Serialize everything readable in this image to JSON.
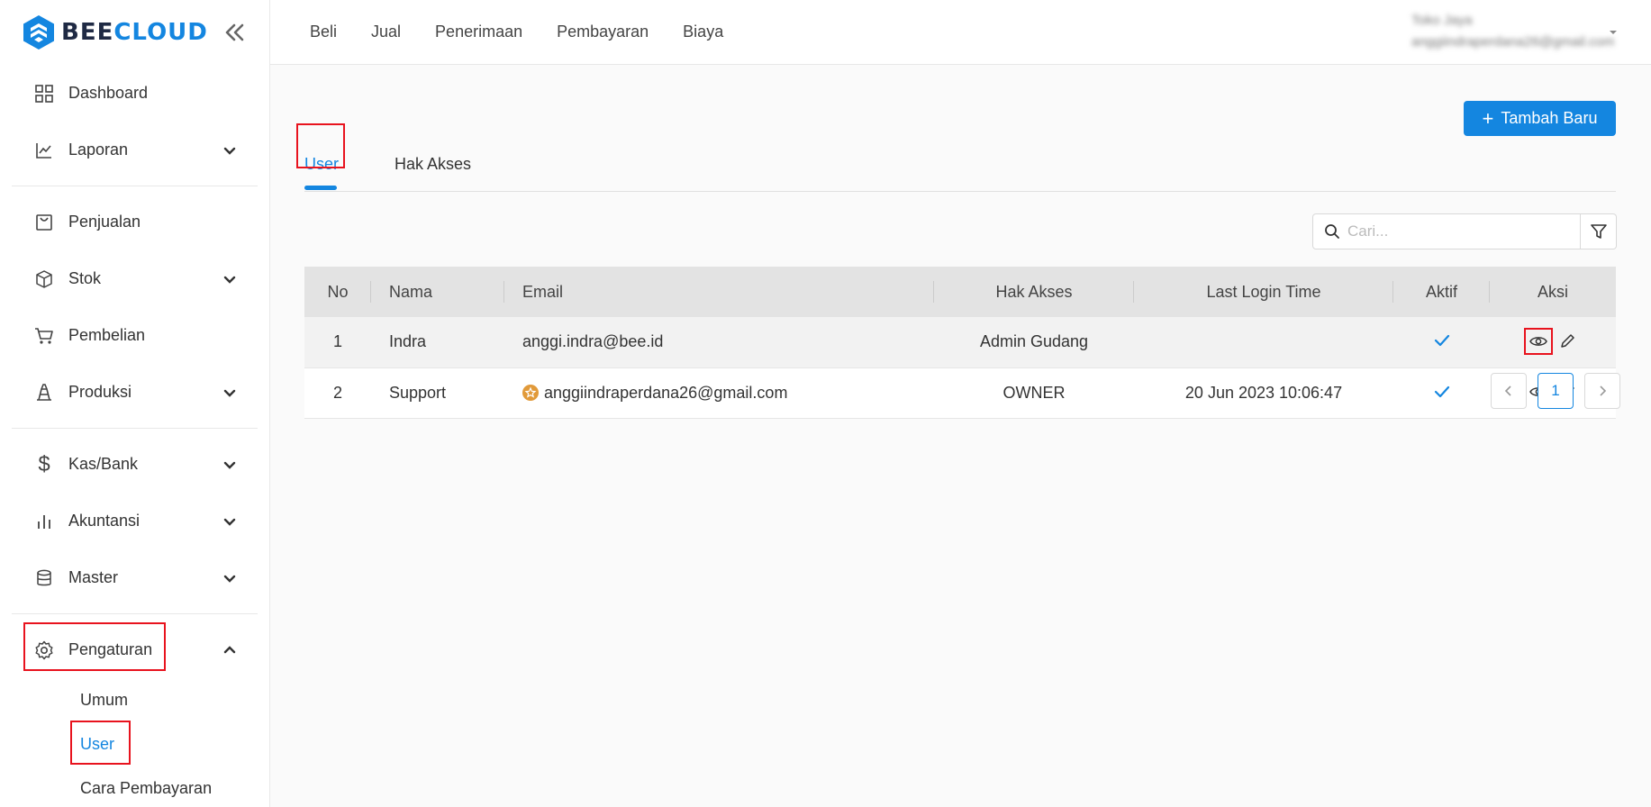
{
  "brand": {
    "part1": "BEE",
    "part2": "CLOUD"
  },
  "sidebar": {
    "items": [
      {
        "label": "Dashboard"
      },
      {
        "label": "Laporan"
      },
      {
        "label": "Penjualan"
      },
      {
        "label": "Stok"
      },
      {
        "label": "Pembelian"
      },
      {
        "label": "Produksi"
      },
      {
        "label": "Kas/Bank"
      },
      {
        "label": "Akuntansi"
      },
      {
        "label": "Master"
      },
      {
        "label": "Pengaturan"
      }
    ],
    "sub_items": [
      {
        "label": "Umum"
      },
      {
        "label": "User"
      },
      {
        "label": "Cara Pembayaran"
      }
    ]
  },
  "topnav": [
    "Beli",
    "Jual",
    "Penerimaan",
    "Pembayaran",
    "Biaya"
  ],
  "user": {
    "company": "Toko Jaya",
    "email": "anggiindraperdana26@gmail.com"
  },
  "main": {
    "add_label": "Tambah Baru",
    "tabs": [
      "User",
      "Hak Akses"
    ],
    "search_placeholder": "Cari...",
    "columns": [
      "No",
      "Nama",
      "Email",
      "Hak Akses",
      "Last Login Time",
      "Aktif",
      "Aksi"
    ],
    "rows": [
      {
        "no": "1",
        "nama": "Indra",
        "email": "anggi.indra@bee.id",
        "hak": "Admin Gudang",
        "login": "",
        "aktif": true
      },
      {
        "no": "2",
        "nama": "Support",
        "email": "anggiindraperdana26@gmail.com",
        "hak": "OWNER",
        "login": "20 Jun 2023 10:06:47",
        "aktif": true
      }
    ],
    "pagination": {
      "current": "1"
    }
  },
  "colors": {
    "accent": "#1486e0",
    "highlight": "#e8131e"
  }
}
